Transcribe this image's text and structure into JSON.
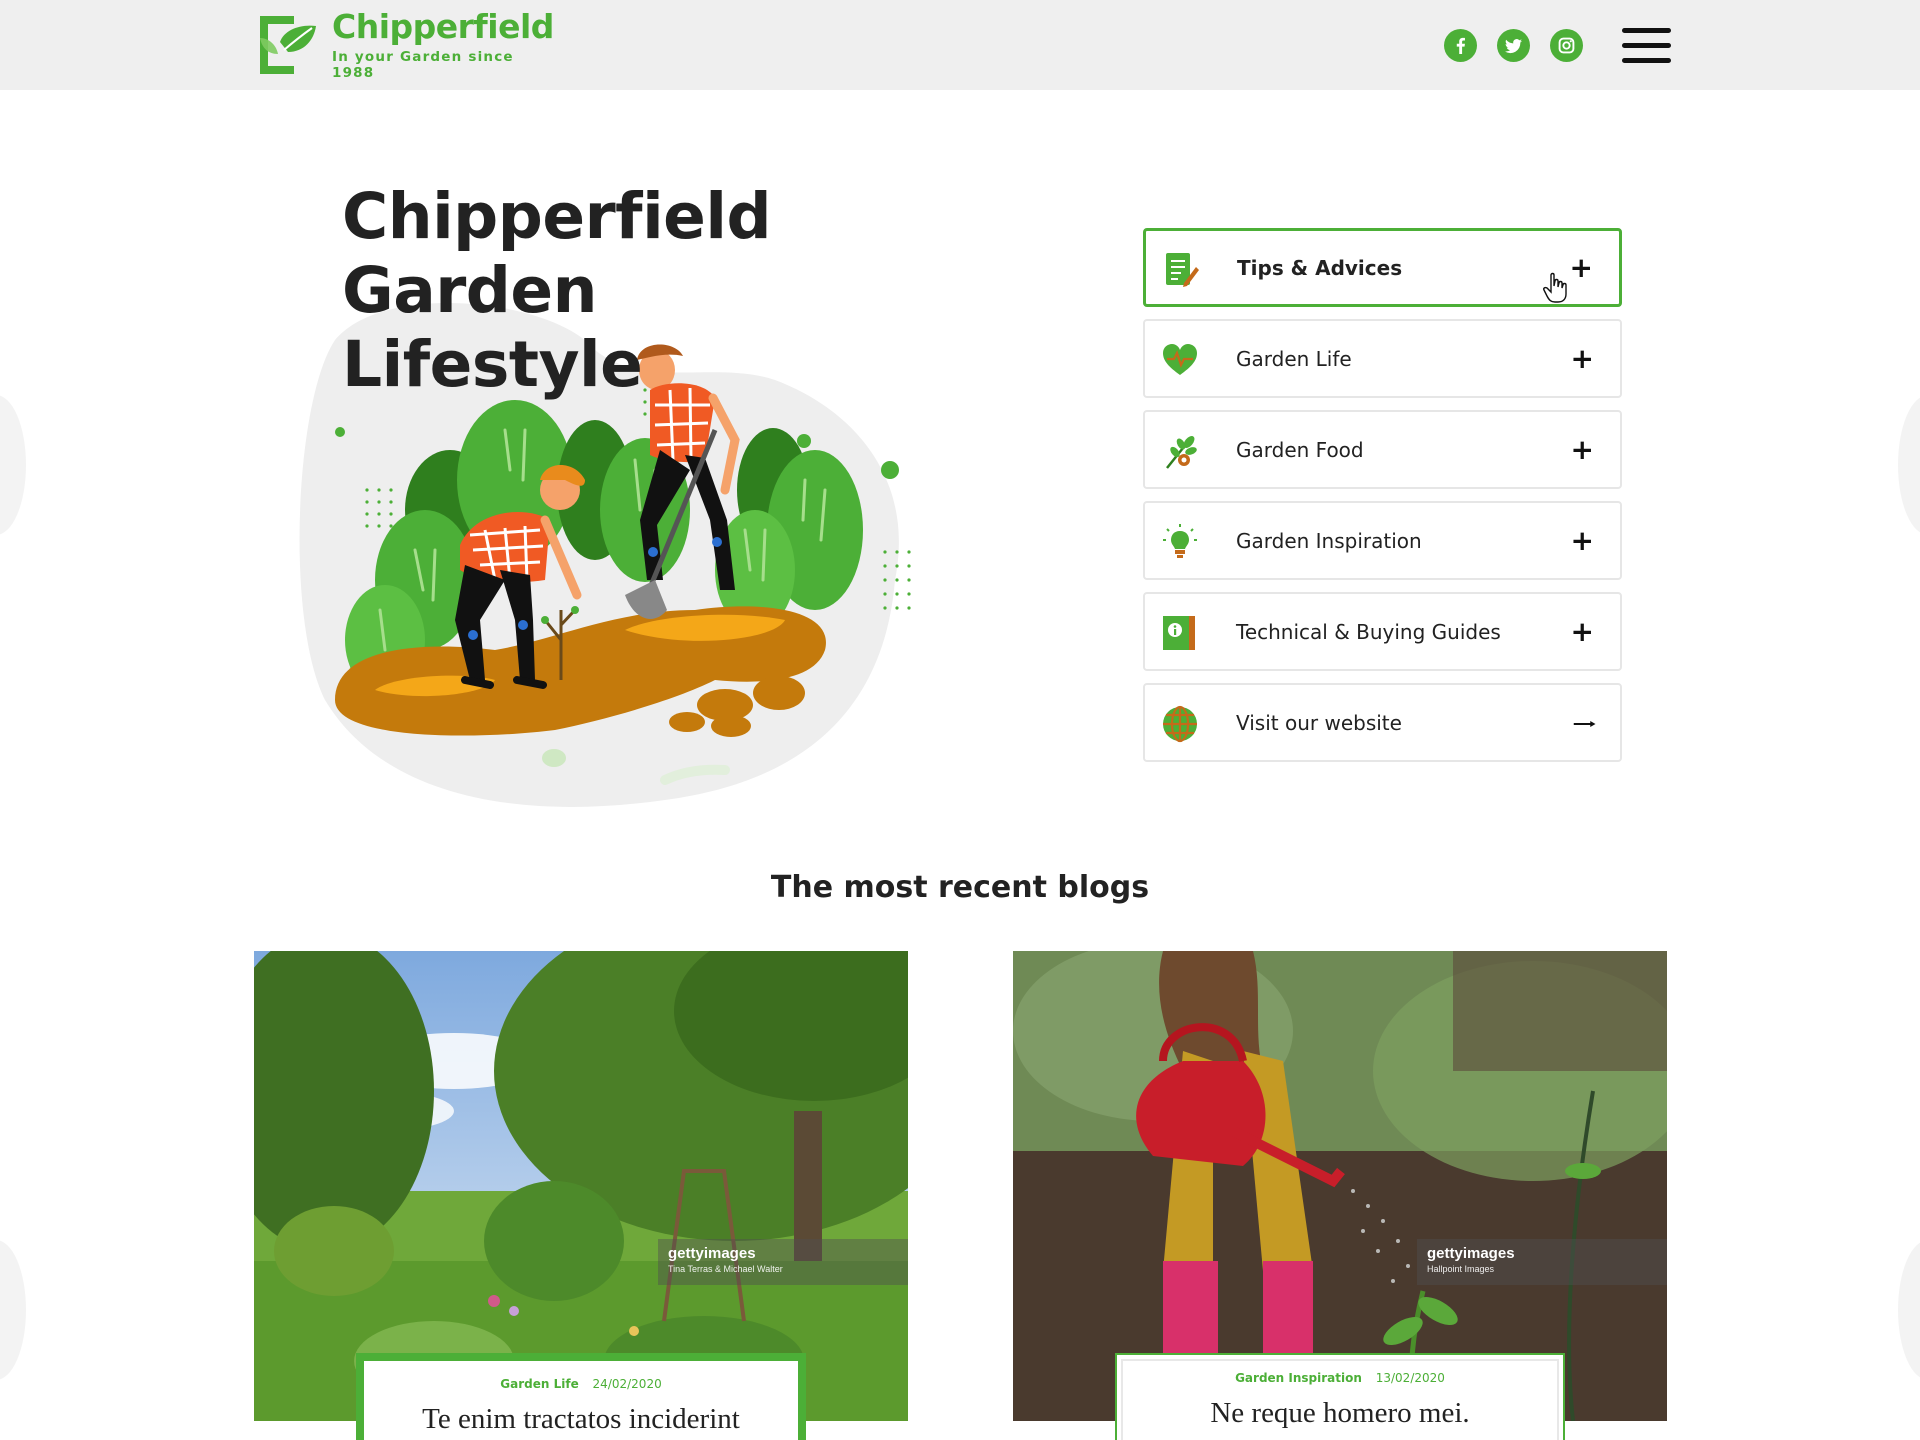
{
  "header": {
    "brand_name": "Chipperfield",
    "brand_tagline": "In your Garden since 1988",
    "social": [
      "facebook-icon",
      "twitter-icon",
      "instagram-icon"
    ],
    "accent_color": "#4caf37"
  },
  "hero": {
    "title_lines": [
      "Chipperfield",
      "Garden",
      "Lifestyle"
    ]
  },
  "menu": {
    "items": [
      {
        "label": "Tips & Advices",
        "icon": "document-pencil-icon",
        "action": "+"
      },
      {
        "label": "Garden Life",
        "icon": "heart-leaf-icon",
        "action": "+"
      },
      {
        "label": "Garden Food",
        "icon": "herb-branch-icon",
        "action": "+"
      },
      {
        "label": "Garden Inspiration",
        "icon": "lightbulb-icon",
        "action": "+"
      },
      {
        "label": "Technical & Buying Guides",
        "icon": "info-book-icon",
        "action": "+"
      },
      {
        "label": "Visit our website",
        "icon": "globe-icon",
        "action": "arrow-right-icon"
      }
    ]
  },
  "blogs": {
    "heading": "The most recent blogs",
    "posts": [
      {
        "category": "Garden Life",
        "date": "24/02/2020",
        "title": "Te enim tractatos inciderint",
        "watermark_brand": "gettyimages",
        "watermark_credit": "Tina Terras & Michael Walter",
        "image_id": "9787196"
      },
      {
        "category": "Garden Inspiration",
        "date": "13/02/2020",
        "title": "Ne reque homero mei.",
        "watermark_brand": "gettyimages",
        "watermark_credit": "Hallpoint Images",
        "image_id": "35"
      }
    ]
  }
}
